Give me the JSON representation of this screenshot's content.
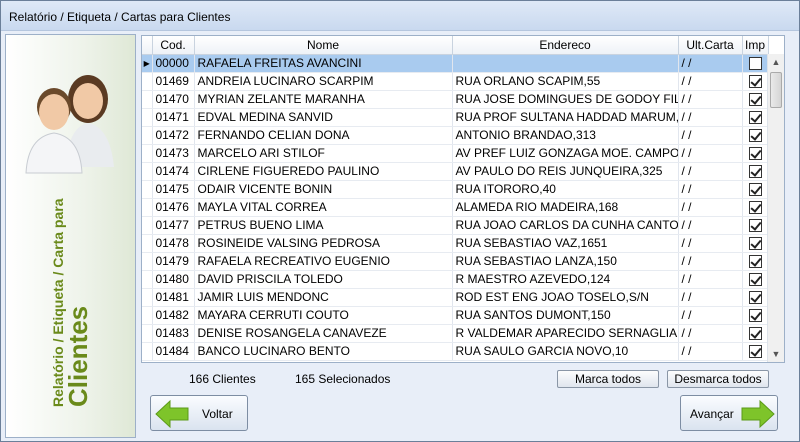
{
  "window": {
    "title": "Relatório / Etiqueta / Cartas para Clientes"
  },
  "side": {
    "line1": "Relatório / Etiqueta / Carta para",
    "line2": "Clientes"
  },
  "grid": {
    "headers": {
      "cod": "Cod.",
      "nome": "Nome",
      "endereco": "Endereco",
      "ult": "Ult.Carta",
      "imp": "Imp"
    },
    "rows": [
      {
        "cod": "00000",
        "nome": "RAFAELA FREITAS AVANCINI",
        "endereco": "",
        "ult": "/ /",
        "checked": false
      },
      {
        "cod": "01469",
        "nome": "ANDREIA LUCINARO SCARPIM",
        "endereco": "RUA ORLANO SCAPIM,55",
        "ult": "/ /",
        "checked": true
      },
      {
        "cod": "01470",
        "nome": "MYRIAN ZELANTE MARANHA",
        "endereco": "RUA JOSE DOMINGUES DE GODOY FIL",
        "ult": "/ /",
        "checked": true
      },
      {
        "cod": "01471",
        "nome": "EDVAL MEDINA SANVID",
        "endereco": "RUA PROF SULTANA HADDAD MARUM,",
        "ult": "/ /",
        "checked": true
      },
      {
        "cod": "01472",
        "nome": "FERNANDO CELIAN DONA",
        "endereco": "ANTONIO BRANDAO,313",
        "ult": "/ /",
        "checked": true
      },
      {
        "cod": "01473",
        "nome": "MARCELO ARI STILOF",
        "endereco": "AV PREF LUIZ GONZAGA MOE. CAMPOS",
        "ult": "/ /",
        "checked": true
      },
      {
        "cod": "01474",
        "nome": "CIRLENE FIGUEREDO PAULINO",
        "endereco": "AV PAULO DO REIS JUNQUEIRA,325",
        "ult": "/ /",
        "checked": true
      },
      {
        "cod": "01475",
        "nome": "ODAIR VICENTE BONIN",
        "endereco": "RUA ITORORO,40",
        "ult": "/ /",
        "checked": true
      },
      {
        "cod": "01476",
        "nome": "MAYLA VITAL CORREA",
        "endereco": "ALAMEDA RIO MADEIRA,168",
        "ult": "/ /",
        "checked": true
      },
      {
        "cod": "01477",
        "nome": "PETRUS BUENO LIMA",
        "endereco": "RUA JOAO CARLOS DA CUNHA CANTO",
        "ult": "/ /",
        "checked": true
      },
      {
        "cod": "01478",
        "nome": "ROSINEIDE VALSING PEDROSA",
        "endereco": "RUA SEBASTIAO VAZ,1651",
        "ult": "/ /",
        "checked": true
      },
      {
        "cod": "01479",
        "nome": "RAFAELA RECREATIVO EUGENIO",
        "endereco": "RUA SEBASTIAO LANZA,150",
        "ult": "/ /",
        "checked": true
      },
      {
        "cod": "01480",
        "nome": "DAVID PRISCILA TOLEDO",
        "endereco": "R MAESTRO AZEVEDO,124",
        "ult": "/ /",
        "checked": true
      },
      {
        "cod": "01481",
        "nome": "JAMIR LUIS MENDONC",
        "endereco": "ROD EST ENG JOAO TOSELO,S/N",
        "ult": "/ /",
        "checked": true
      },
      {
        "cod": "01482",
        "nome": "MAYARA CERRUTI COUTO",
        "endereco": "RUA SANTOS DUMONT,150",
        "ult": "/ /",
        "checked": true
      },
      {
        "cod": "01483",
        "nome": "DENISE ROSANGELA CANAVEZE",
        "endereco": "R VALDEMAR APARECIDO SERNAGLIA,",
        "ult": "/ /",
        "checked": true
      },
      {
        "cod": "01484",
        "nome": "BANCO LUCINARO BENTO",
        "endereco": "RUA SAULO GARCIA NOVO,10",
        "ult": "/ /",
        "checked": true
      }
    ]
  },
  "footer": {
    "clientes": "166 Clientes",
    "selecionados": "165 Selecionados",
    "marca_todos": "Marca todos",
    "desmarca_todos": "Desmarca todos"
  },
  "buttons": {
    "voltar": "Voltar",
    "avancar": "Avançar"
  },
  "colors": {
    "selected_row": "#a9cbef",
    "accent_green": "#6a8a1a",
    "arrow_green": "#7ec42a"
  }
}
